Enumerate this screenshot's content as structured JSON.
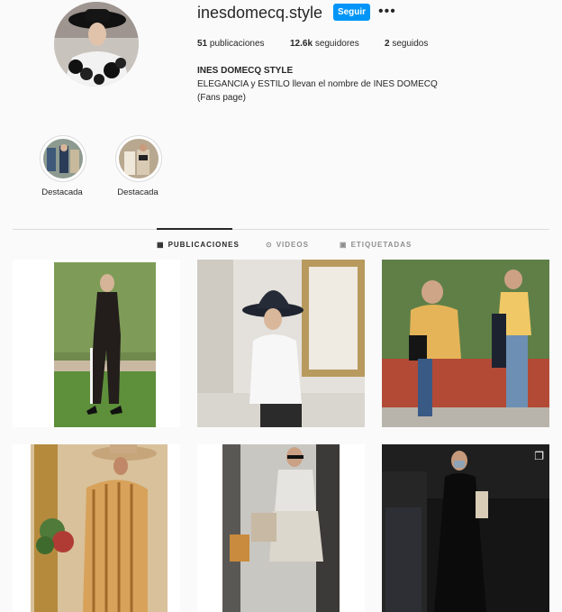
{
  "profile": {
    "username": "inesdomecq.style",
    "follow_label": "Seguir",
    "more_label": "•••",
    "stats": {
      "posts_count": "51",
      "posts_label": "publicaciones",
      "followers_count": "12.6k",
      "followers_label": "seguidores",
      "following_count": "2",
      "following_label": "seguidos"
    },
    "bio_name": "INES DOMECQ STYLE",
    "bio_line1": "ELEGANCIA y ESTILO llevan el nombre de INES DOMECQ",
    "bio_line2": "(Fans page)"
  },
  "highlights": [
    {
      "label": "Destacada"
    },
    {
      "label": "Destacada"
    }
  ],
  "tabs": [
    {
      "label": "PUBLICACIONES",
      "icon": "grid-icon",
      "active": true
    },
    {
      "label": "VIDEOS",
      "icon": "video-icon",
      "active": false
    },
    {
      "label": "ETIQUETADAS",
      "icon": "tag-icon",
      "active": false
    }
  ],
  "colors": {
    "accent": "#0095f6",
    "text": "#262626",
    "muted": "#8e8e8e",
    "border": "#dbdbdb"
  }
}
